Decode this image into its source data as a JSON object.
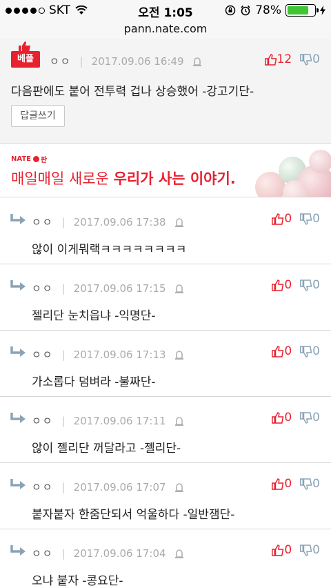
{
  "status": {
    "carrier": "SKT",
    "time": "오전 1:05",
    "battery": "78%",
    "battery_level": 0.78
  },
  "url": "pann.nate.com",
  "best_comment": {
    "badge": "베플",
    "nick": "ㅇㅇ",
    "date": "2017.09.06 16:49",
    "up": "12",
    "down": "0",
    "text": "다음판에도 붙어 전투력 겁나 상승했어 -강고기단-",
    "reply_button": "답글쓰기"
  },
  "banner": {
    "logo_left": "NATE",
    "logo_right": "판",
    "text_plain": "매일매일 새로운 ",
    "text_bold": "우리가 사는 이야기."
  },
  "replies": [
    {
      "nick": "ㅇㅇ",
      "date": "2017.09.06 17:38",
      "up": "0",
      "down": "0",
      "text": "않이 이게뭐랙ㅋㅋㅋㅋㅋㅋㅋㅋ"
    },
    {
      "nick": "ㅇㅇ",
      "date": "2017.09.06 17:15",
      "up": "0",
      "down": "0",
      "text": "젤리단 눈치읍냐 -익명단-"
    },
    {
      "nick": "ㅇㅇ",
      "date": "2017.09.06 17:13",
      "up": "0",
      "down": "0",
      "text": "가소롭다 덤벼라 -불짜단-"
    },
    {
      "nick": "ㅇㅇ",
      "date": "2017.09.06 17:11",
      "up": "0",
      "down": "0",
      "text": "않이 젤리단 꺼달라고 -젤리단-"
    },
    {
      "nick": "ㅇㅇ",
      "date": "2017.09.06 17:07",
      "up": "0",
      "down": "0",
      "text": "붙자붙자 한줌단되서 억울하다 -일반잼단-"
    },
    {
      "nick": "ㅇㅇ",
      "date": "2017.09.06 17:04",
      "up": "0",
      "down": "0",
      "text": "오냐 붙자 -콩요단-"
    }
  ]
}
